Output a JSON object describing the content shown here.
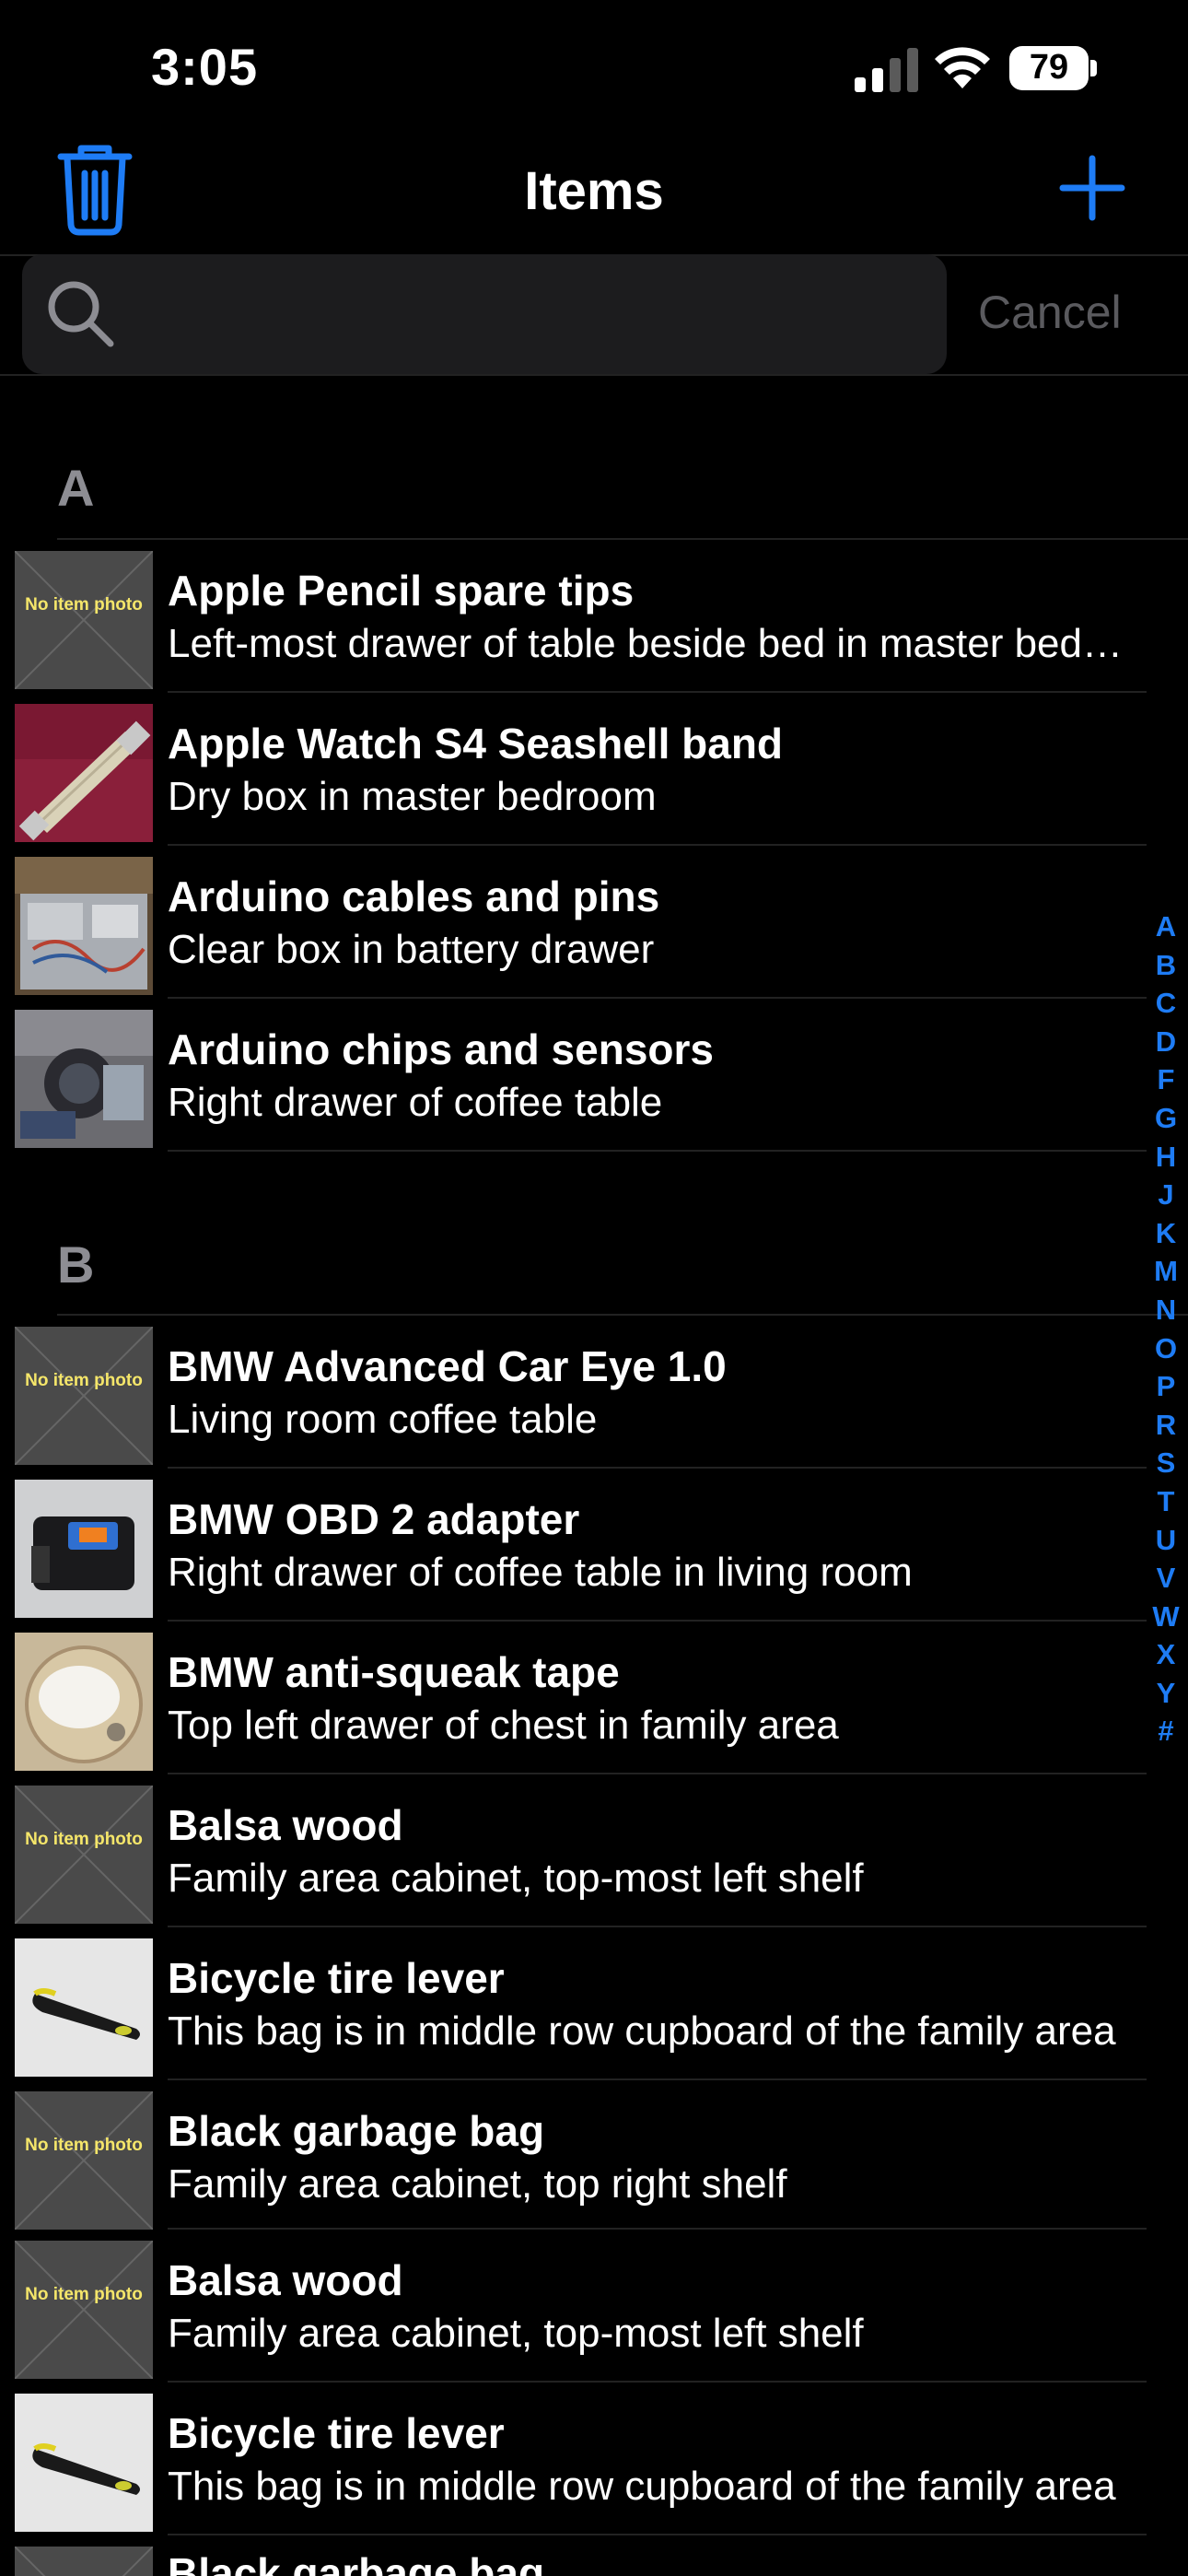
{
  "status": {
    "time": "3:05",
    "battery": "79"
  },
  "nav": {
    "title": "Items"
  },
  "search": {
    "placeholder": "",
    "cancel_label": "Cancel"
  },
  "sections": [
    {
      "letter": "A",
      "items": [
        {
          "title": "Apple Pencil spare tips",
          "subtitle": "Left-most drawer of table beside bed in master bedroom",
          "photo": "none"
        },
        {
          "title": "Apple Watch S4 Seashell band",
          "subtitle": "Dry box in master bedroom",
          "photo": "watch-band"
        },
        {
          "title": "Arduino cables and pins",
          "subtitle": "Clear box in battery drawer",
          "photo": "arduino-cables"
        },
        {
          "title": "Arduino chips and sensors",
          "subtitle": "Right drawer of coffee table",
          "photo": "arduino-chips"
        }
      ]
    },
    {
      "letter": "B",
      "items": [
        {
          "title": "BMW Advanced Car Eye 1.0",
          "subtitle": "Living room coffee table",
          "photo": "none"
        },
        {
          "title": "BMW OBD 2 adapter",
          "subtitle": "Right drawer of coffee table in living room",
          "photo": "obd-adapter"
        },
        {
          "title": "BMW anti-squeak tape",
          "subtitle": "Top left drawer of chest in family area",
          "photo": "tape-roll"
        },
        {
          "title": "Balsa wood",
          "subtitle": "Family area cabinet, top-most left shelf",
          "photo": "none"
        },
        {
          "title": "Bicycle tire lever",
          "subtitle": "This bag is in middle row cupboard of the family area",
          "photo": "tire-lever"
        },
        {
          "title": "Black garbage bag",
          "subtitle": "Family area cabinet, top right shelf",
          "photo": "none"
        },
        {
          "title": "Balsa wood",
          "subtitle": "Family area cabinet, top-most left shelf",
          "photo": "none"
        },
        {
          "title": "Bicycle tire lever",
          "subtitle": "This bag is in middle row cupboard of the family area",
          "photo": "tire-lever"
        },
        {
          "title": "Black garbage bag",
          "subtitle": "",
          "photo": "none"
        }
      ]
    }
  ],
  "no_photo_label": "No item photo",
  "index": [
    "A",
    "B",
    "C",
    "D",
    "F",
    "G",
    "H",
    "J",
    "K",
    "M",
    "N",
    "O",
    "P",
    "R",
    "S",
    "T",
    "U",
    "V",
    "W",
    "X",
    "Y",
    "#"
  ],
  "colors": {
    "accent": "#1e7cf5",
    "background": "#000000",
    "placeholder_text": "#f5e66a"
  }
}
